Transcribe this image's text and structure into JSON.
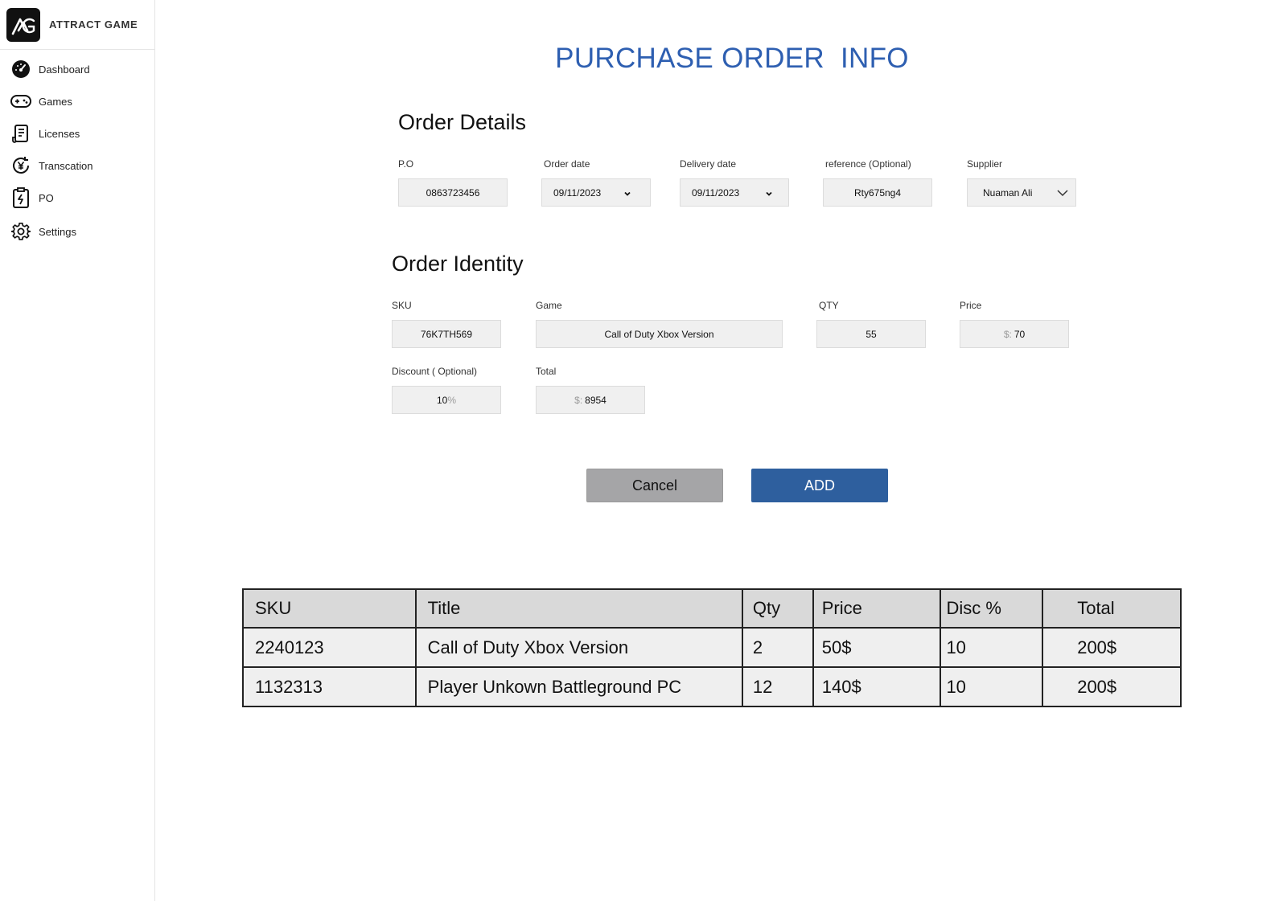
{
  "brand": {
    "name": "ATTRACT GAME"
  },
  "sidebar": {
    "items": [
      {
        "label": "Dashboard",
        "icon": "gauge-icon"
      },
      {
        "label": "Games",
        "icon": "gamepad-icon"
      },
      {
        "label": "Licenses",
        "icon": "license-document-icon"
      },
      {
        "label": "Transcation",
        "icon": "yen-refresh-icon"
      },
      {
        "label": "PO",
        "icon": "clipboard-bolt-icon"
      },
      {
        "label": "Settings",
        "icon": "gear-icon"
      }
    ]
  },
  "page": {
    "title": "PURCHASE ORDER  INFO"
  },
  "order_details": {
    "heading": "Order Details",
    "po": {
      "label": "P.O",
      "value": "0863723456"
    },
    "order_date": {
      "label": "Order date",
      "value": "09/11/2023"
    },
    "delivery_date": {
      "label": "Delivery date",
      "value": "09/11/2023"
    },
    "reference": {
      "label": "reference (Optional)",
      "value": "Rty675ng4"
    },
    "supplier": {
      "label": "Supplier",
      "value": "Nuaman Ali"
    }
  },
  "order_identity": {
    "heading": "Order Identity",
    "sku": {
      "label": "SKU",
      "value": "76K7TH569"
    },
    "game": {
      "label": "Game",
      "value": "Call of Duty Xbox Version"
    },
    "qty": {
      "label": "QTY",
      "value": "55"
    },
    "price": {
      "label": "Price",
      "prefix": "$:",
      "value": "70"
    },
    "discount": {
      "label": "Discount ( Optional)",
      "value": "10",
      "suffix": "%"
    },
    "total": {
      "label": "Total",
      "prefix": "$:",
      "value": "8954"
    }
  },
  "actions": {
    "cancel": "Cancel",
    "add": "ADD"
  },
  "table": {
    "headers": [
      "SKU",
      "Title",
      "Qty",
      "Price",
      "Disc %",
      "Total"
    ],
    "rows": [
      [
        "2240123",
        "Call of Duty Xbox Version",
        "2",
        "50$",
        "10",
        "200$"
      ],
      [
        "1132313",
        "Player Unkown Battleground PC",
        "12",
        "140$",
        "10",
        "200$"
      ]
    ]
  },
  "colors": {
    "accent_title": "#2e5fb1",
    "add_button": "#2e5f9e",
    "cancel_button": "#a5a5a7",
    "field_bg": "#f0f0f0",
    "table_header_bg": "#d9d9d9"
  }
}
